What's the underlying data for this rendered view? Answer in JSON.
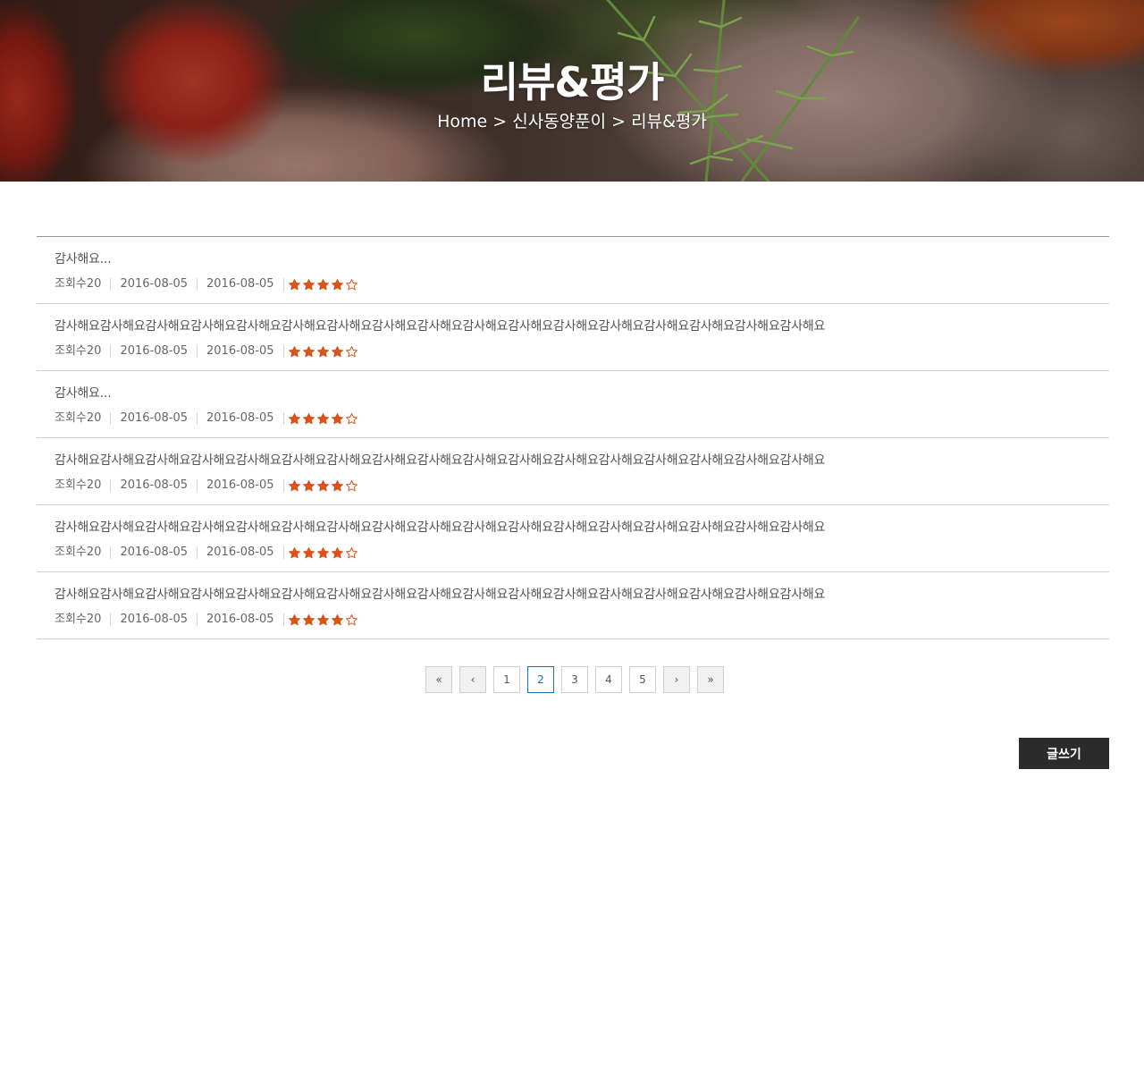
{
  "hero": {
    "title": "리뷰&평가",
    "breadcrumb": "Home > 신사동양푼이 > 리뷰&평가"
  },
  "colors": {
    "star": "#d9541c",
    "active_page": "#1f6fa8",
    "write_button_bg": "#2b2b2b"
  },
  "reviews": [
    {
      "text": "감사해요...",
      "views": "조회수20",
      "date1": "2016-08-05",
      "date2": "2016-08-05",
      "rating": 4,
      "max_rating": 5
    },
    {
      "text": "감사해요감사해요감사해요감사해요감사해요감사해요감사해요감사해요감사해요감사해요감사해요감사해요감사해요감사해요감사해요감사해요감사해요",
      "views": "조회수20",
      "date1": "2016-08-05",
      "date2": "2016-08-05",
      "rating": 4,
      "max_rating": 5
    },
    {
      "text": "감사해요...",
      "views": "조회수20",
      "date1": "2016-08-05",
      "date2": "2016-08-05",
      "rating": 4,
      "max_rating": 5
    },
    {
      "text": "감사해요감사해요감사해요감사해요감사해요감사해요감사해요감사해요감사해요감사해요감사해요감사해요감사해요감사해요감사해요감사해요감사해요",
      "views": "조회수20",
      "date1": "2016-08-05",
      "date2": "2016-08-05",
      "rating": 4,
      "max_rating": 5
    },
    {
      "text": "감사해요감사해요감사해요감사해요감사해요감사해요감사해요감사해요감사해요감사해요감사해요감사해요감사해요감사해요감사해요감사해요감사해요",
      "views": "조회수20",
      "date1": "2016-08-05",
      "date2": "2016-08-05",
      "rating": 4,
      "max_rating": 5
    },
    {
      "text": "감사해요감사해요감사해요감사해요감사해요감사해요감사해요감사해요감사해요감사해요감사해요감사해요감사해요감사해요감사해요감사해요감사해요",
      "views": "조회수20",
      "date1": "2016-08-05",
      "date2": "2016-08-05",
      "rating": 4,
      "max_rating": 5
    }
  ],
  "pagination": {
    "first": "«",
    "prev": "‹",
    "pages": [
      "1",
      "2",
      "3",
      "4",
      "5"
    ],
    "active_page": "2",
    "next": "›",
    "last": "»"
  },
  "write_button": {
    "label": "글쓰기"
  }
}
